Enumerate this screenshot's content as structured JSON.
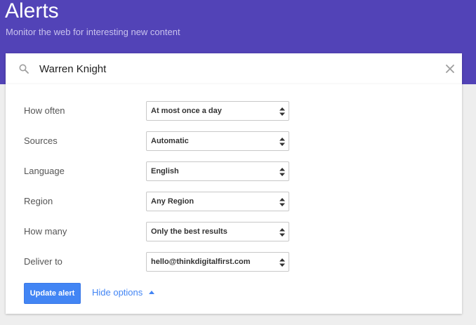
{
  "header": {
    "title": "Alerts",
    "subtitle": "Monitor the web for interesting new content"
  },
  "search": {
    "value": "Warren Knight",
    "icon": "search-icon",
    "clear_icon": "close-icon"
  },
  "options": [
    {
      "label": "How often",
      "value": "At most once a day"
    },
    {
      "label": "Sources",
      "value": "Automatic"
    },
    {
      "label": "Language",
      "value": "English"
    },
    {
      "label": "Region",
      "value": "Any Region"
    },
    {
      "label": "How many",
      "value": "Only the best results"
    },
    {
      "label": "Deliver to",
      "value": "hello@thinkdigitalfirst.com"
    }
  ],
  "actions": {
    "update_label": "Update alert",
    "hide_label": "Hide options"
  },
  "colors": {
    "header_bg": "#5243b7",
    "primary_blue": "#4285f4",
    "page_bg": "#eeeeee"
  }
}
